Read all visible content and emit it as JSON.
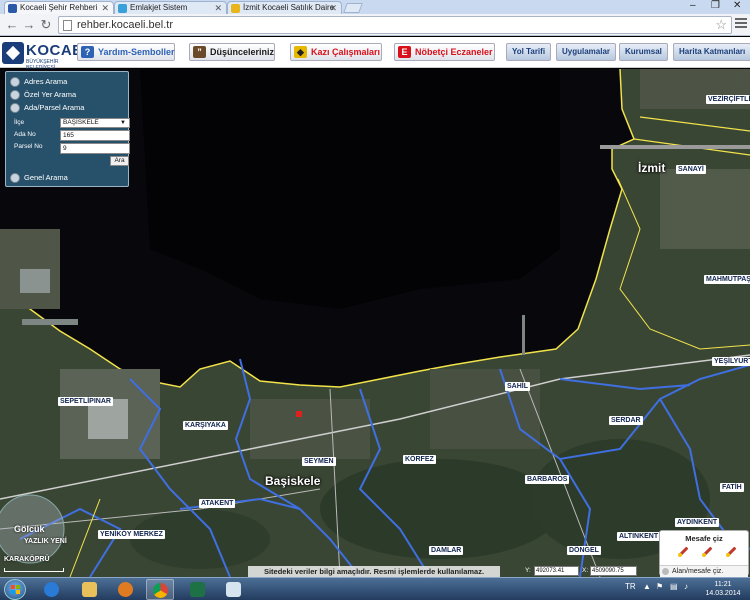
{
  "browser": {
    "tabs": [
      {
        "label": "Kocaeli Şehir Rehberi",
        "favicon_color": "#2b5aa8"
      },
      {
        "label": "Emlakjet Sistem",
        "favicon_color": "#3aa0d8"
      },
      {
        "label": "İzmit Kocaeli Satılık Daire",
        "favicon_color": "#e8b51c"
      }
    ],
    "url": "rehber.kocaeli.bel.tr",
    "window_controls": [
      "–",
      "❐",
      "✕"
    ]
  },
  "site": {
    "logo_text": "KOCAE",
    "logo_sub": "BÜYÜKŞEHİR BELEDİYESİ",
    "header_buttons": [
      {
        "label": "Yardım-Semboller",
        "icon": "help-icon",
        "color": "#2d62b5"
      },
      {
        "label": "Düşünceleriniz",
        "icon": "comment-icon",
        "color": "#1a1a1a"
      },
      {
        "label": "Kazı Çalışmaları",
        "icon": "roadwork-icon",
        "color": "#d8101a"
      },
      {
        "label": "Nöbetçi Eczaneler",
        "icon": "pharmacy-icon",
        "color": "#d8101a"
      }
    ],
    "nav_buttons": [
      "Yol Tarifi",
      "Uygulamalar",
      "Kurumsal",
      "Harita Katmanları"
    ]
  },
  "search_panel": {
    "sections": [
      "Adres Arama",
      "Özel Yer Arama",
      "Ada/Parsel Arama",
      "Genel Arama"
    ],
    "ilce_label": "İlçe",
    "ilce_value": "BAŞİSKELE",
    "ada_label": "Ada No",
    "ada_value": "165",
    "parsel_label": "Parsel No",
    "parsel_value": "9",
    "search_button": "Ara"
  },
  "map": {
    "labels": {
      "izmit": "İzmit",
      "basiskele": "Başiskele",
      "golcuk": "Gölcük",
      "yazlik": "YAZLIK YENİ",
      "karakopru": "KARAKÖPRÜ",
      "vezirciftligi": "VEZİRÇİFTLİĞİ",
      "sanayi": "SANAYİ",
      "mahmutpasa": "MAHMUTPAŞA",
      "yesilyurt": "YEŞİLYURT",
      "sepetlipinar": "SEPETLİPINAR",
      "karsiyaka": "KARŞIYAKA",
      "sahil": "SAHİL",
      "serdar": "SERDAR",
      "seymen": "SEYMEN",
      "korfez": "KÖRFEZ",
      "barbaros": "BARBAROS",
      "fatih": "FATİH",
      "atakent": "ATAKENT",
      "yenikoy": "YENİKÖY MERKEZ",
      "aydinkent": "AYDINKENT",
      "altinkent": "ALTINKENT",
      "damlar": "DAMLAR",
      "dongel": "DÖNGEL"
    },
    "colors": {
      "sea": "#07070c",
      "land": "#3a4634",
      "coast": "#f2e34b",
      "district_border": "#3f6fe0",
      "marker": "#e0201b"
    }
  },
  "disclaimer": "Sitedeki veriler bilgi amaçlıdır. Resmi işlemlerde kullanılamaz.",
  "coordinates": {
    "y_label": "Y:",
    "y_value": "492073.41",
    "x_label": "X:",
    "x_value": "4509090.75"
  },
  "measure": {
    "title": "Mesafe çiz",
    "toggle_label": "Alan/mesafe çiz."
  },
  "taskbar": {
    "apps": [
      "internet-explorer",
      "file-explorer",
      "media-player",
      "chrome",
      "excel",
      "paint"
    ],
    "lang": "TR",
    "time": "11:21",
    "date": "14.03.2014"
  }
}
